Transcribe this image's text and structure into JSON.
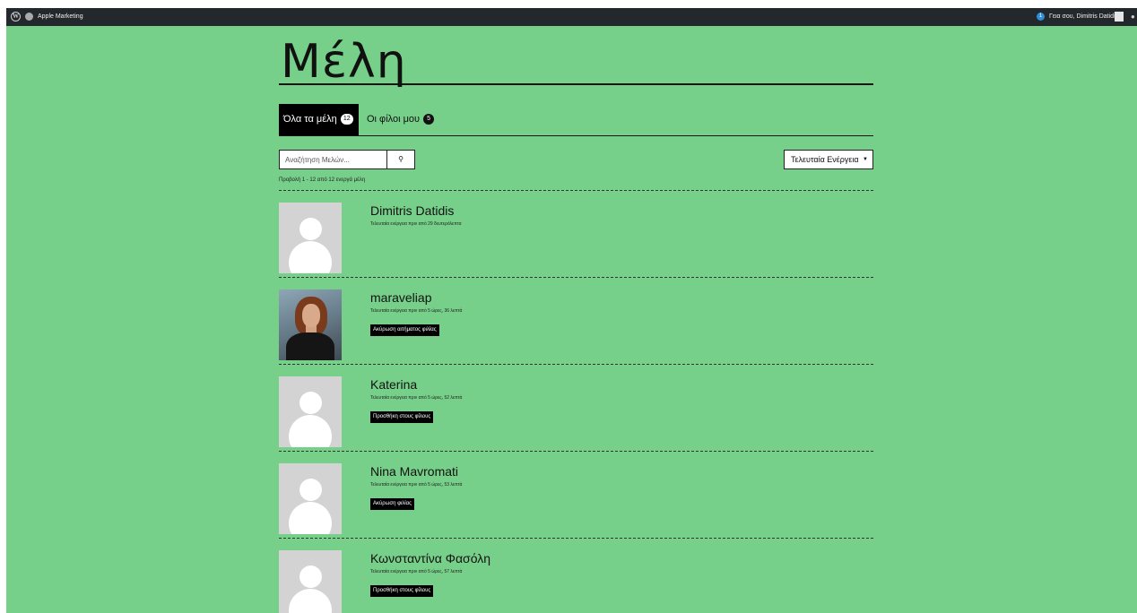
{
  "adminbar": {
    "site_name": "Apple Marketing",
    "notification_count": "1",
    "howdy": "Γεια σου, Dimitris Datidis"
  },
  "page": {
    "title": "Μέλη"
  },
  "tabs": [
    {
      "label": "Όλα τα μέλη",
      "count": "12"
    },
    {
      "label": "Οι φίλοι μου",
      "count": "5"
    }
  ],
  "search": {
    "placeholder": "Αναζήτηση Μελών..."
  },
  "order": {
    "selected": "Τελευταία Ενέργεια"
  },
  "pagination": {
    "count_text": "Προβολή 1 - 12 από 12 ενεργά μέλη"
  },
  "members": [
    {
      "name": "Dimitris Datidis",
      "activity": "Τελευταία ενέργεια πριν από 29 δευτερόλεπτα",
      "button": ""
    },
    {
      "name": "maraveliap",
      "activity": "Τελευταία ενέργεια πριν από 5 ώρες, 36 λεπτά",
      "button": "Ακύρωση αιτήματος φιλίας"
    },
    {
      "name": "Katerina",
      "activity": "Τελευταία ενέργεια πριν από 5 ώρες, 52 λεπτά",
      "button": "Προσθήκη στους φίλους"
    },
    {
      "name": "Nina Mavromati",
      "activity": "Τελευταία ενέργεια πριν από 5 ώρες, 53 λεπτά",
      "button": "Ακύρωση φιλίας"
    },
    {
      "name": "Κωνσταντίνα Φασόλη",
      "activity": "Τελευταία ενέργεια πριν από 5 ώρες, 57 λεπτά",
      "button": "Προσθήκη στους φίλους"
    }
  ]
}
